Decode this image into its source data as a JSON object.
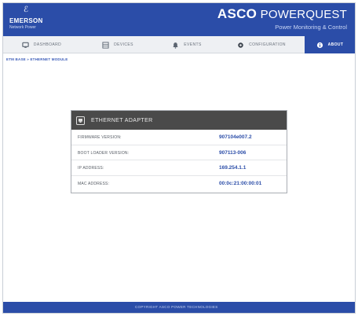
{
  "brand": {
    "emerson_mark": "ℰ",
    "emerson_name": "EMERSON",
    "emerson_sub": "Network Power",
    "asco_bold": "ASCO",
    "asco_light": "POWERQUEST",
    "asco_sub": "Power Monitoring & Control",
    "primary_color": "#2b4da8"
  },
  "nav": {
    "items": [
      {
        "label": "DASHBOARD",
        "icon": "monitor-icon"
      },
      {
        "label": "DEVICES",
        "icon": "devices-icon"
      },
      {
        "label": "EVENTS",
        "icon": "bell-icon"
      },
      {
        "label": "CONFIGURATION",
        "icon": "gear-icon"
      },
      {
        "label": "ABOUT",
        "icon": "info-icon",
        "active": true
      }
    ]
  },
  "breadcrumb": "ETM BASE » ETHERNET MODULE",
  "panel": {
    "title": "ETHERNET ADAPTER",
    "icon": "network-adapter-icon",
    "rows": [
      {
        "label": "FIRMWARE VERSION:",
        "value": "907104e007.2"
      },
      {
        "label": "BOOT LOADER VERSION:",
        "value": "907113-006"
      },
      {
        "label": "IP ADDRESS:",
        "value": "169.254.1.1"
      },
      {
        "label": "MAC ADDRESS:",
        "value": "00:0c:21:00:00:01"
      }
    ]
  },
  "footer": {
    "text": "COPYRIGHT ASCO POWER TECHNOLOGIES"
  }
}
